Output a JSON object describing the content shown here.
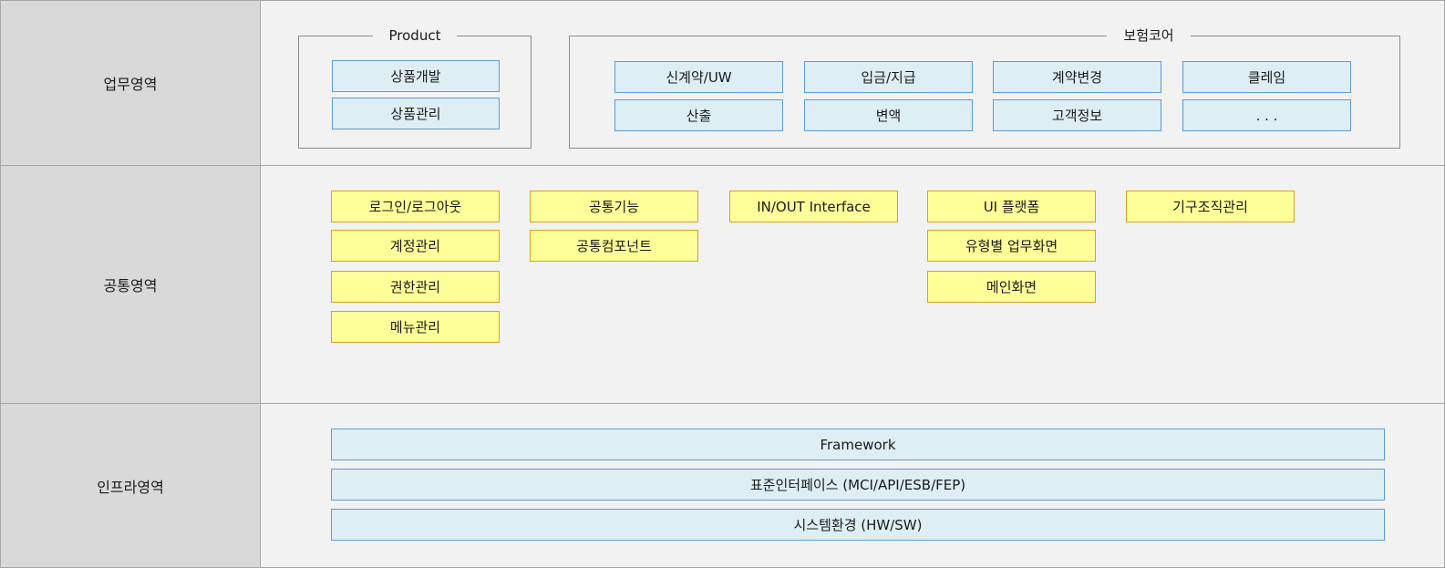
{
  "bands": {
    "business": {
      "label": "업무영역",
      "product_group": {
        "title": "Product",
        "items": [
          "상품개발",
          "상품관리"
        ]
      },
      "insurance_group": {
        "title": "보험코어",
        "items": [
          "신계약/UW",
          "입금/지급",
          "계약변경",
          "클레임",
          "산출",
          "변액",
          "고객정보",
          ". . ."
        ]
      }
    },
    "common": {
      "label": "공통영역",
      "columns": [
        [
          "로그인/로그아웃",
          "계정관리",
          "권한관리",
          "메뉴관리"
        ],
        [
          "공통기능",
          "공통컴포넌트"
        ],
        [
          "IN/OUT Interface"
        ],
        [
          "UI 플랫폼",
          "유형별 업무화면",
          "메인화면"
        ],
        [
          "기구조직관리"
        ]
      ]
    },
    "infra": {
      "label": "인프라영역",
      "items": [
        "Framework",
        "표준인터페이스 (MCI/API/ESB/FEP)",
        "시스템환경 (HW/SW)"
      ]
    }
  },
  "colors": {
    "label_bg": "#d9d9d9",
    "content_bg": "#f2f2f2",
    "blue_fill": "#deeef5",
    "blue_border": "#5b9bd5",
    "yellow_fill": "#ffff99",
    "yellow_border": "#d9a21b"
  }
}
